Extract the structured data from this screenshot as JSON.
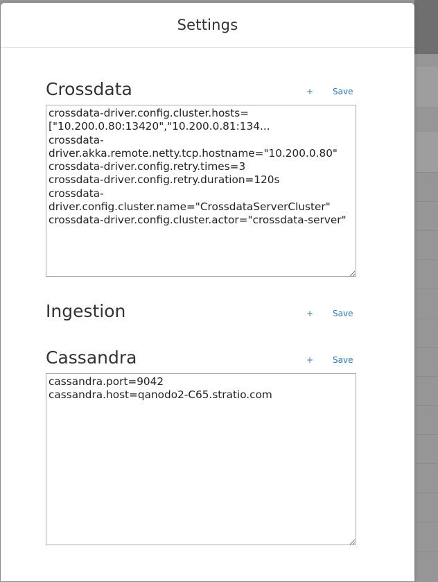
{
  "modal": {
    "title": "Settings"
  },
  "sections": [
    {
      "title": "Crossdata",
      "add_label": "+",
      "save_label": "Save",
      "config": "crossdata-driver.config.cluster.hosts=\n[\"10.200.0.80:13420\",\"10.200.0.81:134...\ncrossdata-\ndriver.akka.remote.netty.tcp.hostname=\"10.200.0.80\"\ncrossdata-driver.config.retry.times=3\ncrossdata-driver.config.retry.duration=120s\ncrossdata-\ndriver.config.cluster.name=\"CrossdataServerCluster\"\ncrossdata-driver.config.cluster.actor=\"crossdata-server\""
    },
    {
      "title": "Ingestion",
      "add_label": "+",
      "save_label": "Save"
    },
    {
      "title": "Cassandra",
      "add_label": "+",
      "save_label": "Save",
      "config": "cassandra.port=9042\ncassandra.host=qanodo2-C65.stratio.com"
    }
  ],
  "colors": {
    "link": "#2a7ab8",
    "text": "#333333",
    "overlay": "#9a9a9a"
  }
}
